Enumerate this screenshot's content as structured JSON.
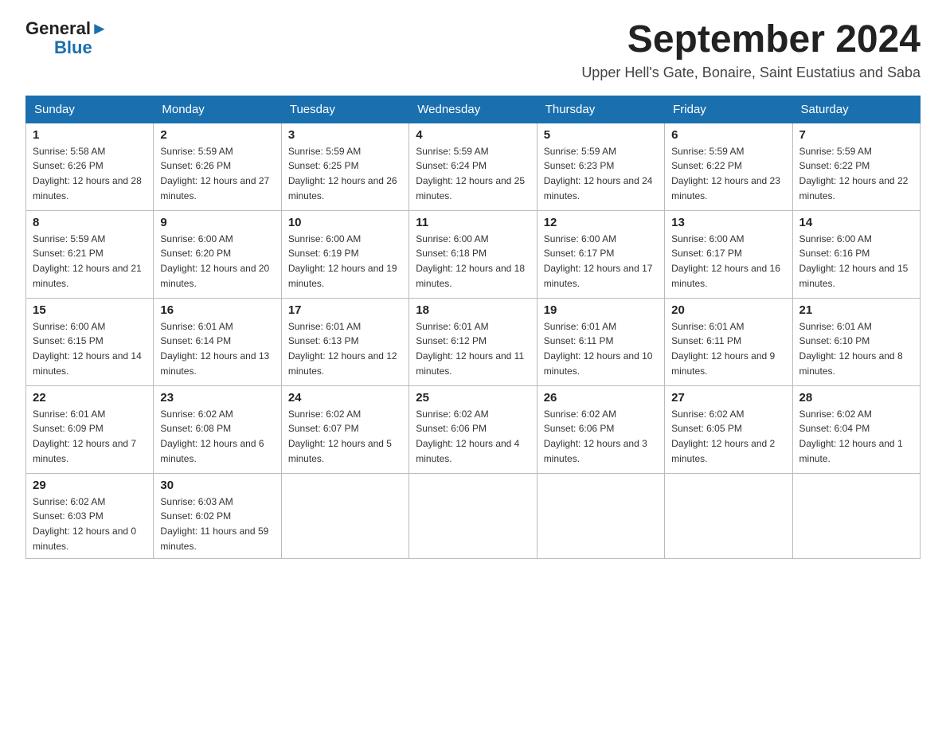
{
  "logo": {
    "general": "General",
    "blue_triangle": "▶",
    "blue": "Blue"
  },
  "header": {
    "month_year": "September 2024",
    "location": "Upper Hell's Gate, Bonaire, Saint Eustatius and Saba"
  },
  "weekdays": [
    "Sunday",
    "Monday",
    "Tuesday",
    "Wednesday",
    "Thursday",
    "Friday",
    "Saturday"
  ],
  "weeks": [
    [
      {
        "day": "1",
        "sunrise": "5:58 AM",
        "sunset": "6:26 PM",
        "daylight": "12 hours and 28 minutes."
      },
      {
        "day": "2",
        "sunrise": "5:59 AM",
        "sunset": "6:26 PM",
        "daylight": "12 hours and 27 minutes."
      },
      {
        "day": "3",
        "sunrise": "5:59 AM",
        "sunset": "6:25 PM",
        "daylight": "12 hours and 26 minutes."
      },
      {
        "day": "4",
        "sunrise": "5:59 AM",
        "sunset": "6:24 PM",
        "daylight": "12 hours and 25 minutes."
      },
      {
        "day": "5",
        "sunrise": "5:59 AM",
        "sunset": "6:23 PM",
        "daylight": "12 hours and 24 minutes."
      },
      {
        "day": "6",
        "sunrise": "5:59 AM",
        "sunset": "6:22 PM",
        "daylight": "12 hours and 23 minutes."
      },
      {
        "day": "7",
        "sunrise": "5:59 AM",
        "sunset": "6:22 PM",
        "daylight": "12 hours and 22 minutes."
      }
    ],
    [
      {
        "day": "8",
        "sunrise": "5:59 AM",
        "sunset": "6:21 PM",
        "daylight": "12 hours and 21 minutes."
      },
      {
        "day": "9",
        "sunrise": "6:00 AM",
        "sunset": "6:20 PM",
        "daylight": "12 hours and 20 minutes."
      },
      {
        "day": "10",
        "sunrise": "6:00 AM",
        "sunset": "6:19 PM",
        "daylight": "12 hours and 19 minutes."
      },
      {
        "day": "11",
        "sunrise": "6:00 AM",
        "sunset": "6:18 PM",
        "daylight": "12 hours and 18 minutes."
      },
      {
        "day": "12",
        "sunrise": "6:00 AM",
        "sunset": "6:17 PM",
        "daylight": "12 hours and 17 minutes."
      },
      {
        "day": "13",
        "sunrise": "6:00 AM",
        "sunset": "6:17 PM",
        "daylight": "12 hours and 16 minutes."
      },
      {
        "day": "14",
        "sunrise": "6:00 AM",
        "sunset": "6:16 PM",
        "daylight": "12 hours and 15 minutes."
      }
    ],
    [
      {
        "day": "15",
        "sunrise": "6:00 AM",
        "sunset": "6:15 PM",
        "daylight": "12 hours and 14 minutes."
      },
      {
        "day": "16",
        "sunrise": "6:01 AM",
        "sunset": "6:14 PM",
        "daylight": "12 hours and 13 minutes."
      },
      {
        "day": "17",
        "sunrise": "6:01 AM",
        "sunset": "6:13 PM",
        "daylight": "12 hours and 12 minutes."
      },
      {
        "day": "18",
        "sunrise": "6:01 AM",
        "sunset": "6:12 PM",
        "daylight": "12 hours and 11 minutes."
      },
      {
        "day": "19",
        "sunrise": "6:01 AM",
        "sunset": "6:11 PM",
        "daylight": "12 hours and 10 minutes."
      },
      {
        "day": "20",
        "sunrise": "6:01 AM",
        "sunset": "6:11 PM",
        "daylight": "12 hours and 9 minutes."
      },
      {
        "day": "21",
        "sunrise": "6:01 AM",
        "sunset": "6:10 PM",
        "daylight": "12 hours and 8 minutes."
      }
    ],
    [
      {
        "day": "22",
        "sunrise": "6:01 AM",
        "sunset": "6:09 PM",
        "daylight": "12 hours and 7 minutes."
      },
      {
        "day": "23",
        "sunrise": "6:02 AM",
        "sunset": "6:08 PM",
        "daylight": "12 hours and 6 minutes."
      },
      {
        "day": "24",
        "sunrise": "6:02 AM",
        "sunset": "6:07 PM",
        "daylight": "12 hours and 5 minutes."
      },
      {
        "day": "25",
        "sunrise": "6:02 AM",
        "sunset": "6:06 PM",
        "daylight": "12 hours and 4 minutes."
      },
      {
        "day": "26",
        "sunrise": "6:02 AM",
        "sunset": "6:06 PM",
        "daylight": "12 hours and 3 minutes."
      },
      {
        "day": "27",
        "sunrise": "6:02 AM",
        "sunset": "6:05 PM",
        "daylight": "12 hours and 2 minutes."
      },
      {
        "day": "28",
        "sunrise": "6:02 AM",
        "sunset": "6:04 PM",
        "daylight": "12 hours and 1 minute."
      }
    ],
    [
      {
        "day": "29",
        "sunrise": "6:02 AM",
        "sunset": "6:03 PM",
        "daylight": "12 hours and 0 minutes."
      },
      {
        "day": "30",
        "sunrise": "6:03 AM",
        "sunset": "6:02 PM",
        "daylight": "11 hours and 59 minutes."
      },
      null,
      null,
      null,
      null,
      null
    ]
  ],
  "labels": {
    "sunrise": "Sunrise:",
    "sunset": "Sunset:",
    "daylight": "Daylight: "
  }
}
